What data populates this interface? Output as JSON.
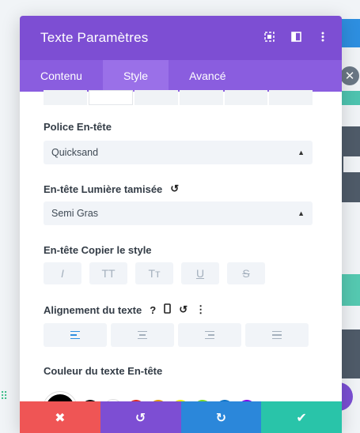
{
  "header": {
    "title": "Texte Paramètres",
    "icons": [
      "expand-icon",
      "split-view-icon",
      "more-options-icon"
    ]
  },
  "tabs": [
    {
      "label": "Contenu",
      "active": false
    },
    {
      "label": "Style",
      "active": true
    },
    {
      "label": "Avancé",
      "active": false
    }
  ],
  "fields": {
    "police_entete": {
      "label": "Police En-tête",
      "value": "Quicksand"
    },
    "lumiere": {
      "label": "En-tête Lumière tamisée",
      "value": "Semi Gras"
    },
    "copier_style": {
      "label": "En-tête Copier le style",
      "buttons": [
        {
          "label": "I",
          "name": "italic"
        },
        {
          "label": "TT",
          "name": "uppercase"
        },
        {
          "label": "Tт",
          "name": "small-caps"
        },
        {
          "label": "U",
          "name": "underline"
        },
        {
          "label": "S",
          "name": "strikethrough"
        }
      ]
    },
    "alignement": {
      "label": "Alignement du texte",
      "help_glyph": "?",
      "options": [
        "align-left",
        "align-center",
        "align-right",
        "align-justify"
      ],
      "selected": "align-left"
    },
    "couleur": {
      "label": "Couleur du texte En-tête",
      "swatches": [
        "#000000",
        "#111111",
        "#ffffff",
        "#e02b20",
        "#e09900",
        "#edf000",
        "#7cda24",
        "#0c71c3",
        "#8300e9"
      ]
    }
  },
  "footer": {
    "colors": {
      "cancel": "#ef5555",
      "undo": "#7d4ed3",
      "redo": "#2b87da",
      "save": "#29c4a9"
    }
  },
  "accent": "#7d4ed3"
}
